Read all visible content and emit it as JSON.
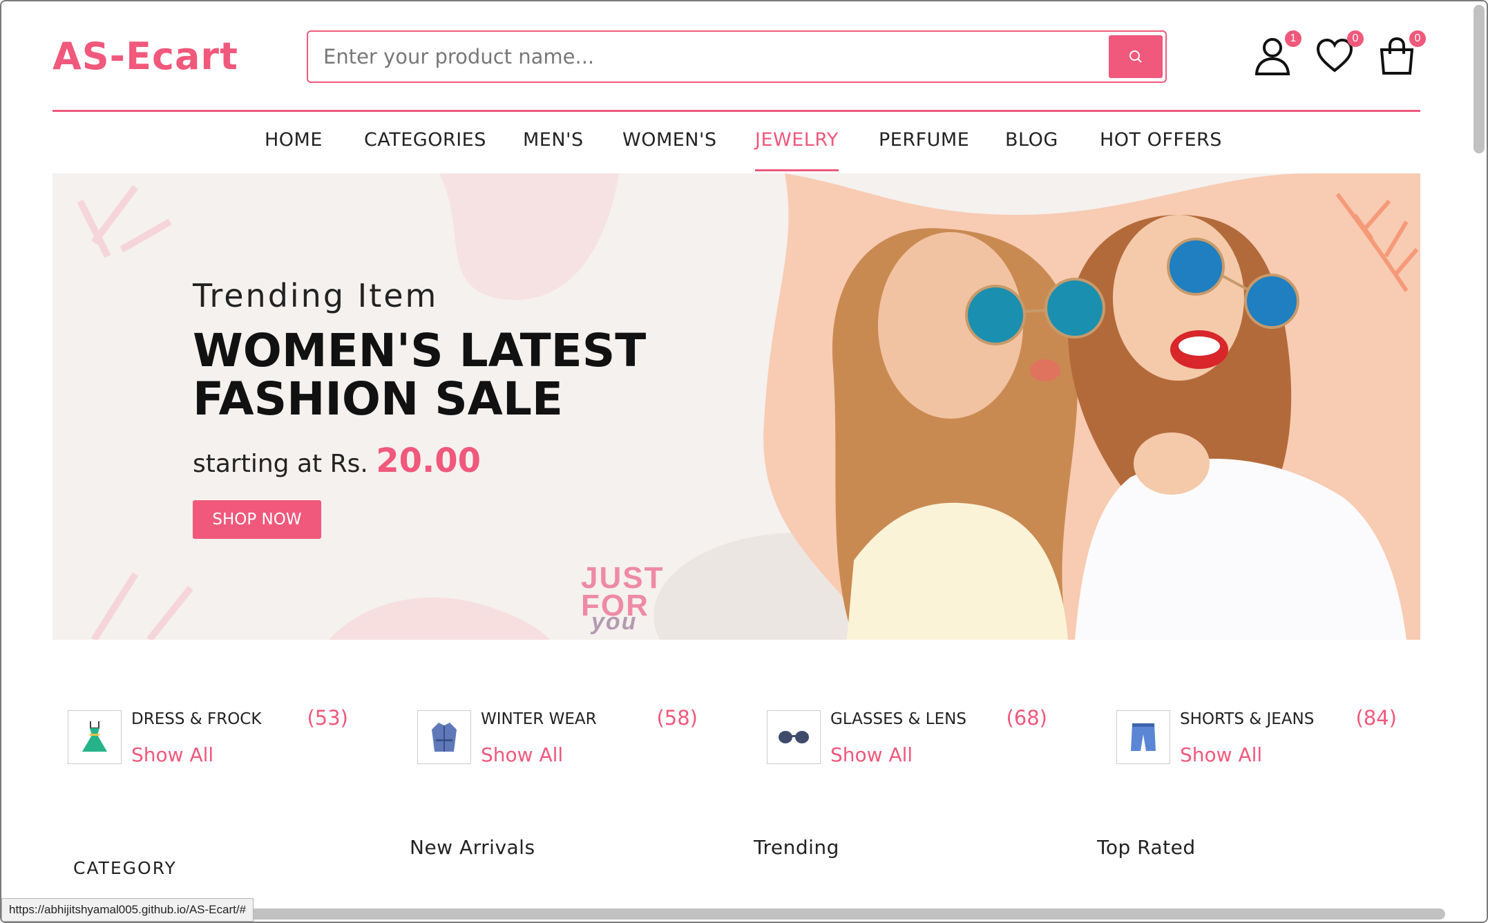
{
  "header": {
    "logo": "AS-Ecart",
    "search_placeholder": "Enter your product name...",
    "badges": {
      "account": "1",
      "wishlist": "0",
      "cart": "0"
    }
  },
  "nav": {
    "items": [
      "HOME",
      "CATEGORIES",
      "MEN'S",
      "WOMEN'S",
      "JEWELRY",
      "PERFUME",
      "BLOG",
      "HOT OFFERS"
    ],
    "active": "JEWELRY"
  },
  "hero": {
    "subtitle": "Trending Item",
    "title": "WOMEN'S LATEST FASHION SALE",
    "price_prefix": "starting at Rs.",
    "price": "20.00",
    "button": "SHOP NOW",
    "badge_line1": "JUST",
    "badge_line2": "FOR",
    "badge_line3": "you"
  },
  "categories": [
    {
      "name": "DRESS & FROCK",
      "count": "(53)",
      "link": "Show All",
      "icon": "dress-icon"
    },
    {
      "name": "WINTER WEAR",
      "count": "(58)",
      "link": "Show All",
      "icon": "coat-icon"
    },
    {
      "name": "GLASSES & LENS",
      "count": "(68)",
      "link": "Show All",
      "icon": "glasses-icon"
    },
    {
      "name": "SHORTS & JEANS",
      "count": "(84)",
      "link": "Show All",
      "icon": "shorts-icon"
    }
  ],
  "sections": {
    "category": "CATEGORY",
    "new_arrivals": "New Arrivals",
    "trending": "Trending",
    "top_rated": "Top Rated"
  },
  "status_url": "https://abhijitshyamal005.github.io/AS-Ecart/#",
  "colors": {
    "accent": "#f0587c",
    "hero_bg": "#f4f1ee",
    "hero_peach": "#f8cbb3"
  }
}
